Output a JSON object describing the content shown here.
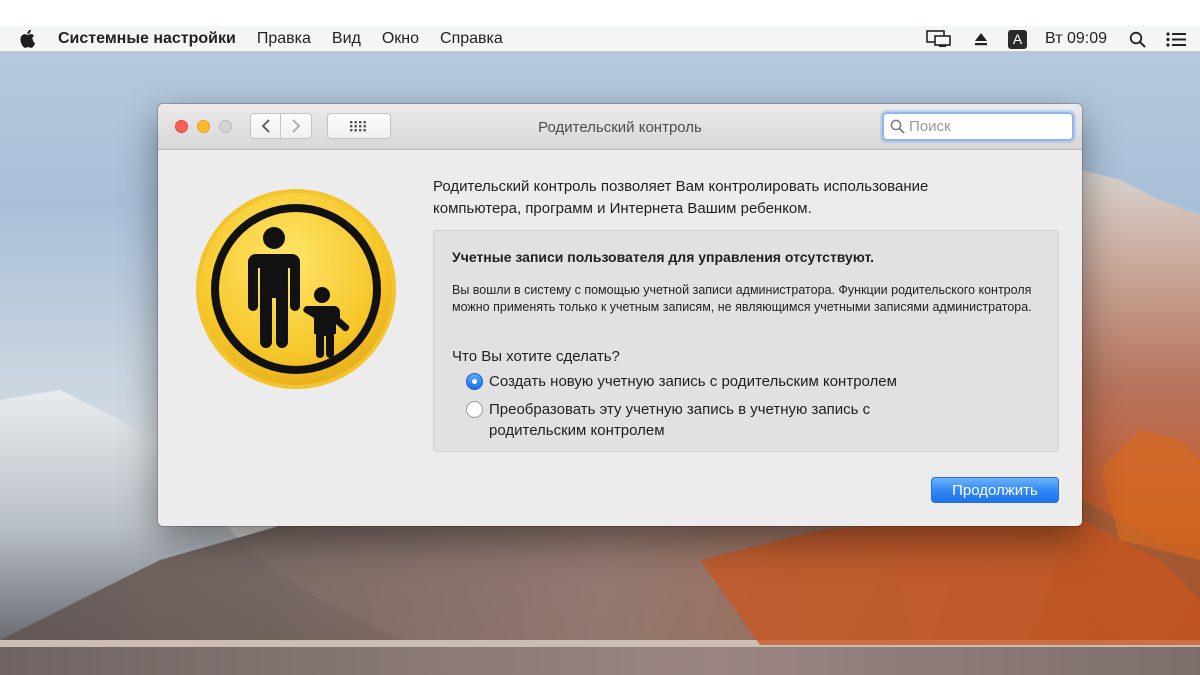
{
  "menubar": {
    "app_name": "Системные настройки",
    "items": [
      "Правка",
      "Вид",
      "Окно",
      "Справка"
    ],
    "input_badge": "A",
    "clock": "Вт 09:09",
    "icons": [
      "apple-icon",
      "screen-mirroring-icon",
      "eject-icon",
      "input-source-icon",
      "spotlight-search-icon",
      "notification-center-icon"
    ]
  },
  "window": {
    "title": "Родительский контроль",
    "search_placeholder": "Поиск",
    "search_value": ""
  },
  "content": {
    "intro": "Родительский контроль позволяет Вам контролировать использование компьютера, программ и Интернета Вашим ребенком.",
    "panel_heading": "Учетные записи пользователя для управления отсутствуют.",
    "panel_text": "Вы вошли в систему с помощью учетной записи администратора. Функции родительского контроля можно применять только к учетным записям, не являющимся учетными записями администратора.",
    "question": "Что Вы хотите сделать?",
    "options": [
      {
        "label": "Создать новую учетную запись с родительским контролем",
        "selected": true
      },
      {
        "label": "Преобразовать эту учетную запись в учетную запись с родительским контролем",
        "selected": false
      }
    ],
    "continue_label": "Продолжить"
  },
  "colors": {
    "accent": "#2f86f5",
    "icon_yellow": "#f7cf2e",
    "close": "#ff5f57",
    "minimize": "#febc2e"
  }
}
